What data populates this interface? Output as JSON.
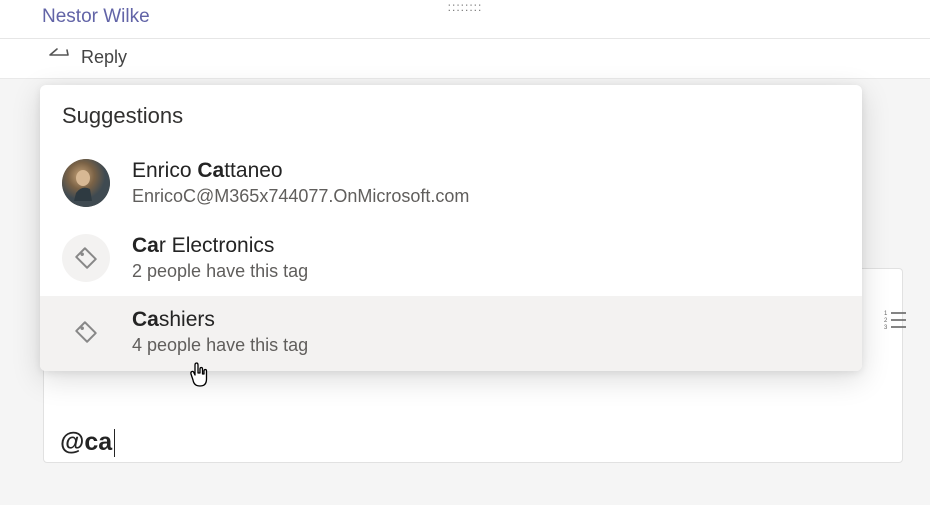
{
  "header": {
    "sender_name": "Nestor Wilke"
  },
  "reply": {
    "label": "Reply"
  },
  "suggestions": {
    "header": "Suggestions",
    "items": [
      {
        "type": "person",
        "name_bold": "Ca",
        "name_rest": "ttaneo",
        "name_prefix": "Enrico ",
        "subtitle": "EnricoC@M365x744077.OnMicrosoft.com"
      },
      {
        "type": "tag",
        "name_bold": "Ca",
        "name_rest": "r Electronics",
        "name_prefix": "",
        "subtitle": "2 people have this tag"
      },
      {
        "type": "tag",
        "name_bold": "Ca",
        "name_rest": "shiers",
        "name_prefix": "",
        "subtitle": "4 people have this tag"
      }
    ]
  },
  "compose": {
    "mention_text": "@ca"
  },
  "drag_handle": "::::::::"
}
